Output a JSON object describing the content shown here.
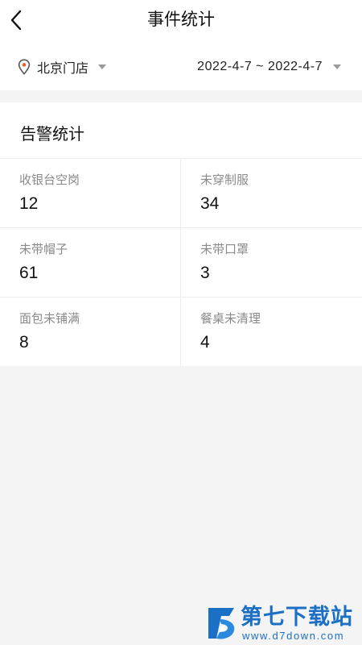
{
  "header": {
    "title": "事件统计",
    "back_icon": "chevron-left-icon"
  },
  "filters": {
    "store": {
      "icon": "location-pin-icon",
      "label": "北京门店"
    },
    "date_range": {
      "label": "2022-4-7 ~ 2022-4-7"
    }
  },
  "alarm_stats": {
    "title": "告警统计",
    "items": [
      {
        "label": "收银台空岗",
        "value": "12"
      },
      {
        "label": "未穿制服",
        "value": "34"
      },
      {
        "label": "未带帽子",
        "value": "61"
      },
      {
        "label": "未带口罩",
        "value": "3"
      },
      {
        "label": "面包未铺满",
        "value": "8"
      },
      {
        "label": "餐桌未清理",
        "value": "4"
      }
    ]
  },
  "watermark": {
    "title": "第七下载站",
    "url": "www.d7down.com",
    "color": "#1b6fc4"
  },
  "colors": {
    "background": "#f4f4f4",
    "card": "#ffffff",
    "muted_text": "#8a8a8a",
    "divider": "#ededed"
  }
}
